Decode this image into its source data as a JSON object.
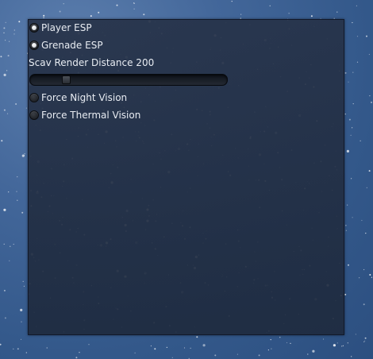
{
  "menu": {
    "toggles": [
      {
        "label": "Player ESP",
        "checked": true
      },
      {
        "label": "Grenade ESP",
        "checked": true
      }
    ],
    "scav_render": {
      "label": "Scav Render Distance 200",
      "value": 200,
      "slider_fraction": 0.16
    },
    "vision_toggles": [
      {
        "label": "Force Night Vision",
        "checked": false
      },
      {
        "label": "Force Thermal Vision",
        "checked": false
      }
    ]
  }
}
